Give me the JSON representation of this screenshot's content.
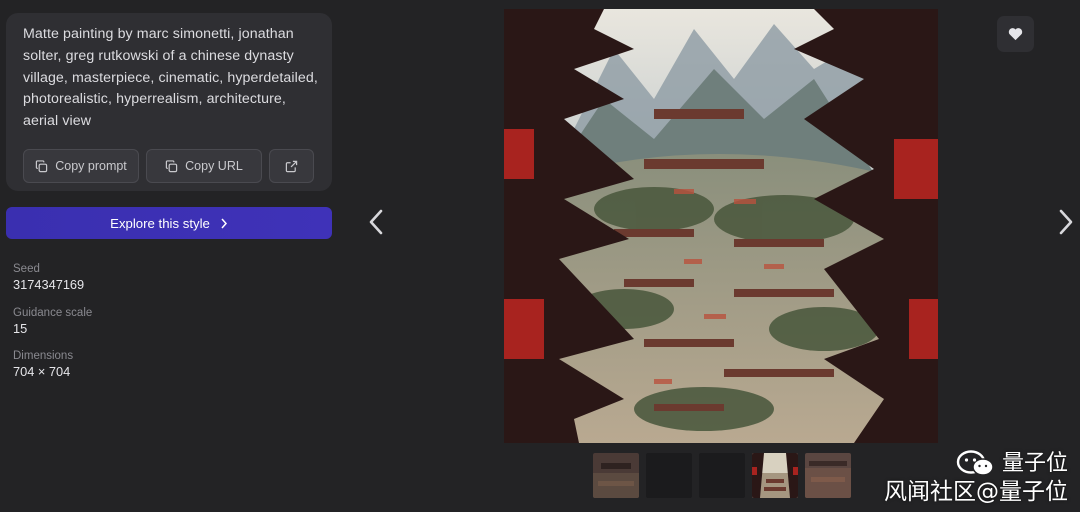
{
  "prompt": {
    "text": "Matte painting by marc simonetti, jonathan solter, greg rutkowski of a chinese dynasty village, masterpiece, cinematic, hyperdetailed, photorealistic, hyperrealism, architecture, aerial view",
    "copy_prompt_label": "Copy prompt",
    "copy_url_label": "Copy URL",
    "external_icon": "external-link-icon"
  },
  "explore": {
    "label": "Explore this style",
    "icon": "chevron-right-icon",
    "color": "#3b30b3"
  },
  "meta": [
    {
      "label": "Seed",
      "value": "3174347169"
    },
    {
      "label": "Guidance scale",
      "value": "15"
    },
    {
      "label": "Dimensions",
      "value": "704 × 704"
    }
  ],
  "navigation": {
    "prev_icon": "chevron-left-icon",
    "next_icon": "chevron-right-icon"
  },
  "like": {
    "icon": "heart-icon"
  },
  "thumbnails": {
    "count": 5,
    "selected_index": 3
  },
  "watermark": {
    "line1": "量子位",
    "line2": "风闻社区@量子位",
    "icon": "wechat-icon"
  }
}
